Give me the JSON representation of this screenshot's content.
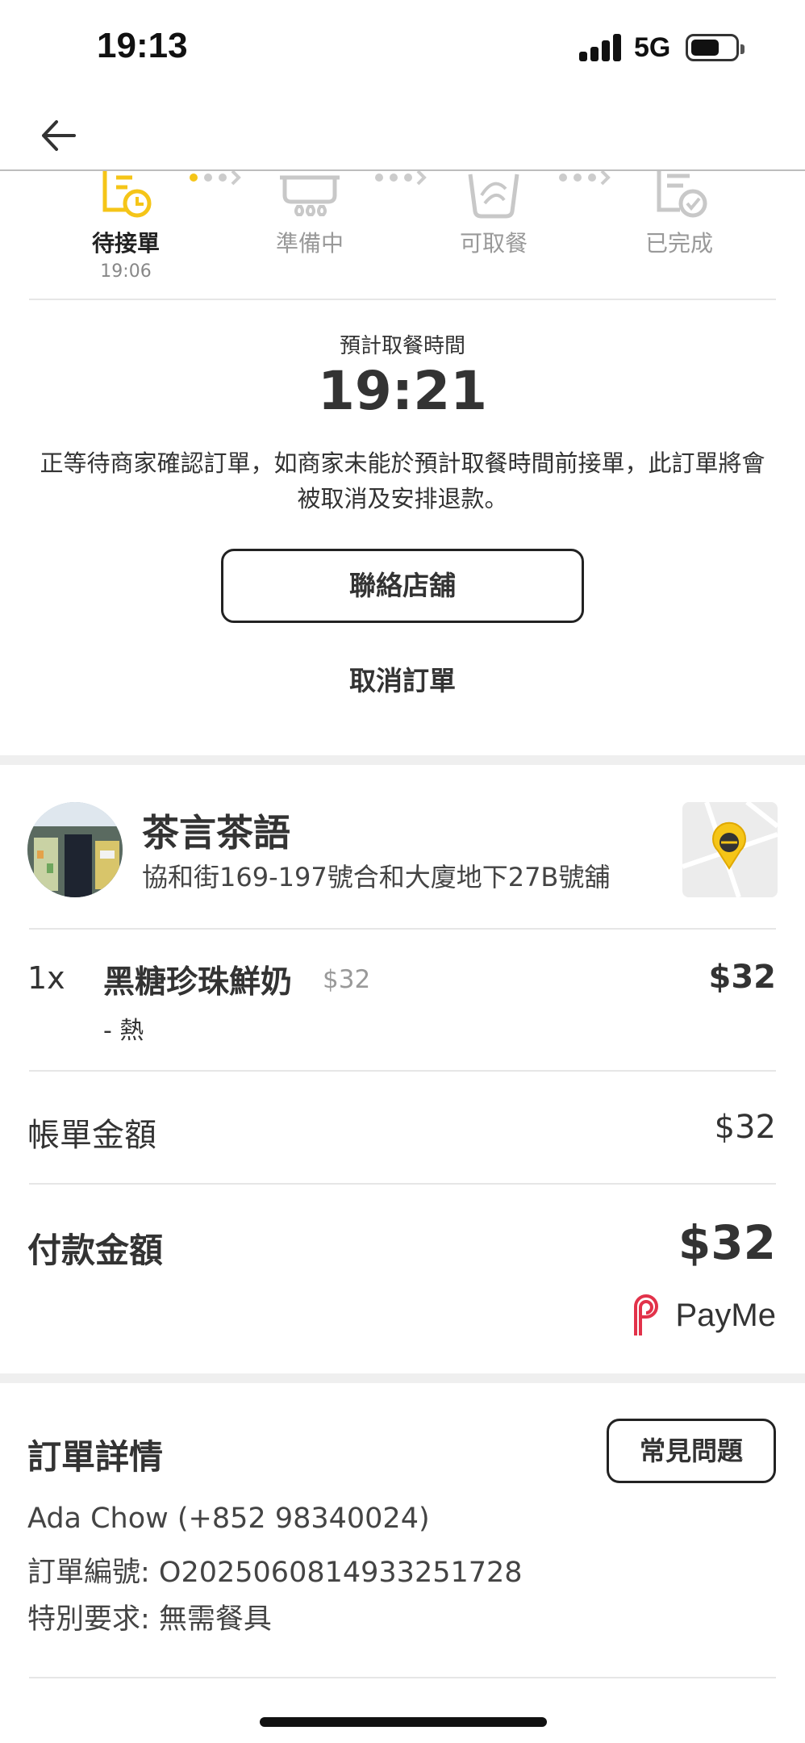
{
  "status_bar": {
    "time": "19:13",
    "network": "5G"
  },
  "progress": {
    "steps": [
      {
        "label": "待接單",
        "time": "19:06",
        "state": "active"
      },
      {
        "label": "準備中",
        "state": "pending"
      },
      {
        "label": "可取餐",
        "state": "pending"
      },
      {
        "label": "已完成",
        "state": "pending"
      }
    ],
    "active_color": "#F5C518",
    "inactive_color": "#BDBDBD"
  },
  "eta": {
    "label": "預計取餐時間",
    "time": "19:21",
    "notice": "正等待商家確認訂單，如商家未能於預計取餐時間前接單，此訂單將會被取消及安排退款。"
  },
  "actions": {
    "contact_store": "聯絡店舖",
    "cancel_order": "取消訂單"
  },
  "store": {
    "name": "茶言茶語",
    "address": "協和街169-197號合和大廈地下27B號舖"
  },
  "items": [
    {
      "qty": "1x",
      "name": "黑糖珍珠鮮奶",
      "unit_price": "$32",
      "total": "$32",
      "option": "- 熱"
    }
  ],
  "summary": {
    "bill_label": "帳單金額",
    "bill_amount": "$32",
    "pay_label": "付款金額",
    "pay_amount": "$32",
    "payment_method": "PayMe",
    "payment_icon": "payme-logo-icon"
  },
  "details": {
    "title": "訂單詳情",
    "faq_button": "常見問題",
    "customer": "Ada Chow (+852 98340024)",
    "order_number": "訂單編號: O2025060814933251728",
    "special_request": "特別要求: 無需餐具"
  }
}
